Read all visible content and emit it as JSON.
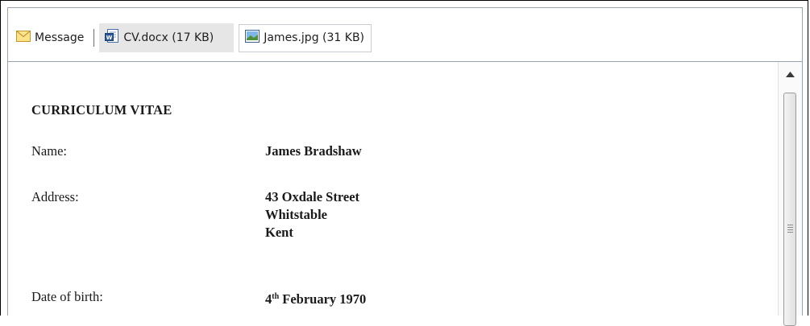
{
  "attachments": {
    "message_label": "Message",
    "items": [
      {
        "label": "CV.docx (17 KB)",
        "icon": "word-document-icon"
      },
      {
        "label": "James.jpg (31 KB)",
        "icon": "image-file-icon"
      }
    ]
  },
  "document": {
    "heading": "CURRICULUM VITAE",
    "name_label": "Name:",
    "name_value": "James Bradshaw",
    "address_label": "Address:",
    "address_lines": [
      "43 Oxdale Street",
      "Whitstable",
      "Kent"
    ],
    "dob_label": "Date of birth:",
    "dob_day": "4",
    "dob_suffix": "th",
    "dob_rest": " February 1970"
  },
  "colors": {
    "selected_tab": "#e6e6e6",
    "border": "#9aa4b1"
  }
}
